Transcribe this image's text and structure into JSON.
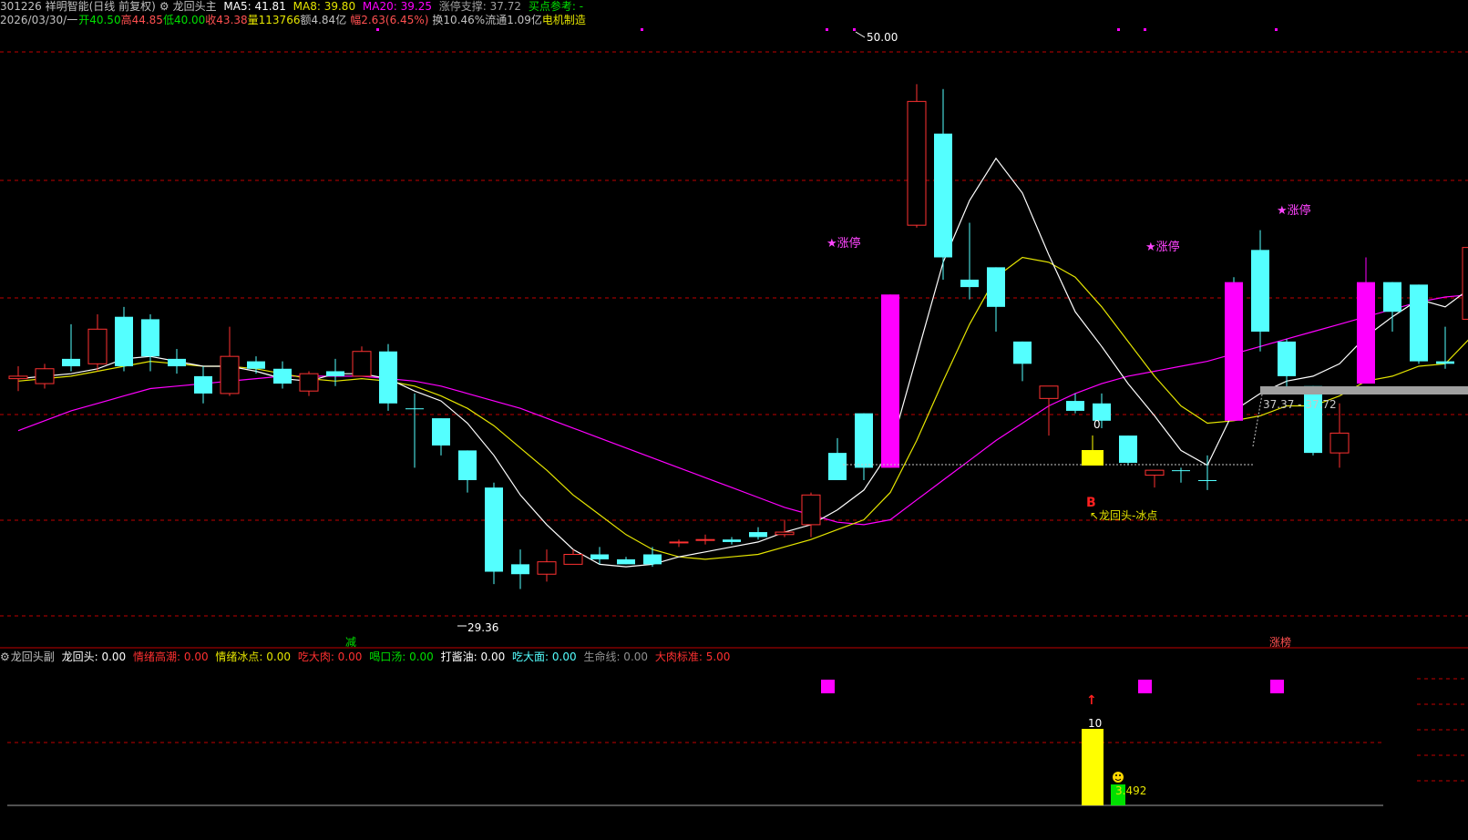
{
  "header": {
    "line1": {
      "code_name": "301226 祥明智能(日线 前复权)",
      "indicator_name": "龙回头主",
      "ma5": "MA5: 41.81",
      "ma8": "MA8: 39.80",
      "ma20": "MA20: 39.25",
      "limit_support": "涨停支撑: 37.72",
      "buy_ref": "买点参考: -"
    },
    "line2": {
      "date": "2026/03/30/一",
      "open": "开40.50",
      "high": "高44.85",
      "low": "低40.00",
      "close": "收43.38",
      "volume": "量113766",
      "amount": "额4.84亿",
      "change": "幅2.63(6.45%)",
      "turnover": "换10.46%",
      "float": "流通1.09亿",
      "sector": "电机制造"
    }
  },
  "colors": {
    "background": "#000000",
    "up_candle": "#ff3232",
    "down_candle": "#54ffff",
    "limit_up_bar": "#ff00ff",
    "ma5": "#ffffff",
    "ma8": "#e5e500",
    "ma20": "#ff00ff",
    "grid": "#8b0000"
  },
  "annotations": {
    "high_label": "50.00",
    "low_label": "29.36",
    "limit_up": "★涨停",
    "b_marker": "B",
    "dragon_text": "↖龙回头-冰点",
    "zero_label": "0",
    "support_range": "37.37 - 37.72",
    "jian": "减",
    "zhangbang": "涨榜"
  },
  "subheader": {
    "name": "龙回头副",
    "longhuitou": "龙回头: 0.00",
    "qingxu_gaochao": "情绪高潮: 0.00",
    "qingxu_bingdian": "情绪冰点: 0.00",
    "chi_darou": "吃大肉: 0.00",
    "he_koutang": "喝口汤: 0.00",
    "da_jiangyou": "打酱油: 0.00",
    "chi_damian": "吃大面: 0.00",
    "shengmingxian": "生命线: 0.00",
    "darou_biaozhun": "大肉标准: 5.00"
  },
  "sub_labels": {
    "ten": "10",
    "value": "3.492"
  },
  "chart_data": {
    "type": "candlestick",
    "ylim": [
      28,
      52
    ],
    "candles": [
      {
        "o": 38.2,
        "h": 38.6,
        "l": 37.6,
        "c": 38.1,
        "up": true
      },
      {
        "o": 38.5,
        "h": 38.7,
        "l": 37.7,
        "c": 37.9,
        "up": true
      },
      {
        "o": 38.6,
        "h": 40.3,
        "l": 38.4,
        "c": 38.9,
        "up": false
      },
      {
        "o": 40.1,
        "h": 40.7,
        "l": 38.4,
        "c": 38.7,
        "up": true
      },
      {
        "o": 38.6,
        "h": 41.0,
        "l": 38.4,
        "c": 40.6,
        "up": false
      },
      {
        "o": 40.5,
        "h": 40.7,
        "l": 38.4,
        "c": 39.0,
        "up": false
      },
      {
        "o": 38.9,
        "h": 39.3,
        "l": 38.3,
        "c": 38.6,
        "up": false
      },
      {
        "o": 38.2,
        "h": 38.6,
        "l": 37.1,
        "c": 37.5,
        "up": false
      },
      {
        "o": 37.5,
        "h": 40.2,
        "l": 37.4,
        "c": 39.0,
        "up": true
      },
      {
        "o": 38.8,
        "h": 39.0,
        "l": 38.3,
        "c": 38.5,
        "up": false
      },
      {
        "o": 38.5,
        "h": 38.8,
        "l": 37.7,
        "c": 37.9,
        "up": false
      },
      {
        "o": 37.6,
        "h": 38.4,
        "l": 37.4,
        "c": 38.3,
        "up": true
      },
      {
        "o": 38.4,
        "h": 38.9,
        "l": 37.8,
        "c": 38.2,
        "up": false
      },
      {
        "o": 38.2,
        "h": 39.4,
        "l": 38.2,
        "c": 39.2,
        "up": true
      },
      {
        "o": 39.2,
        "h": 39.5,
        "l": 36.8,
        "c": 37.1,
        "up": false
      },
      {
        "o": 36.9,
        "h": 37.5,
        "l": 34.5,
        "c": 36.9,
        "up": false
      },
      {
        "o": 36.5,
        "h": 36.5,
        "l": 35.0,
        "c": 35.4,
        "up": false
      },
      {
        "o": 35.2,
        "h": 35.2,
        "l": 33.5,
        "c": 34.0,
        "up": false
      },
      {
        "o": 33.7,
        "h": 33.9,
        "l": 29.8,
        "c": 30.3,
        "up": false
      },
      {
        "o": 30.6,
        "h": 31.2,
        "l": 29.6,
        "c": 30.2,
        "up": false
      },
      {
        "o": 30.2,
        "h": 31.2,
        "l": 29.9,
        "c": 30.7,
        "up": true
      },
      {
        "o": 30.6,
        "h": 31.2,
        "l": 30.6,
        "c": 31.0,
        "up": true
      },
      {
        "o": 31.0,
        "h": 31.3,
        "l": 30.6,
        "c": 30.8,
        "up": false
      },
      {
        "o": 30.8,
        "h": 30.9,
        "l": 30.6,
        "c": 30.6,
        "up": false
      },
      {
        "o": 31.0,
        "h": 31.3,
        "l": 30.5,
        "c": 30.6,
        "up": false
      },
      {
        "o": 31.5,
        "h": 31.6,
        "l": 31.3,
        "c": 31.5,
        "up": true
      },
      {
        "o": 31.6,
        "h": 31.8,
        "l": 31.4,
        "c": 31.6,
        "up": true
      },
      {
        "o": 31.6,
        "h": 31.7,
        "l": 31.4,
        "c": 31.5,
        "up": false
      },
      {
        "o": 31.9,
        "h": 32.1,
        "l": 31.6,
        "c": 31.7,
        "up": false
      },
      {
        "o": 31.8,
        "h": 32.4,
        "l": 31.7,
        "c": 31.9,
        "up": true
      },
      {
        "o": 32.2,
        "h": 33.5,
        "l": 31.7,
        "c": 33.4,
        "up": true
      },
      {
        "o": 35.1,
        "h": 35.7,
        "l": 34.0,
        "c": 34.0,
        "up": false
      },
      {
        "o": 36.7,
        "h": 36.7,
        "l": 34.0,
        "c": 34.5,
        "up": false
      },
      {
        "o": 34.5,
        "h": 41.5,
        "l": 34.5,
        "c": 41.5,
        "up": true,
        "limit": true
      },
      {
        "o": 44.3,
        "h": 50.0,
        "l": 44.2,
        "c": 49.3,
        "up": true
      },
      {
        "o": 48.0,
        "h": 49.8,
        "l": 42.1,
        "c": 43.0,
        "up": false
      },
      {
        "o": 42.1,
        "h": 44.4,
        "l": 41.3,
        "c": 41.8,
        "up": false
      },
      {
        "o": 42.6,
        "h": 42.6,
        "l": 40.0,
        "c": 41.0,
        "up": false
      },
      {
        "o": 39.6,
        "h": 39.6,
        "l": 38.0,
        "c": 38.7,
        "up": false
      },
      {
        "o": 37.8,
        "h": 37.8,
        "l": 35.8,
        "c": 37.3,
        "up": true
      },
      {
        "o": 37.2,
        "h": 37.5,
        "l": 36.7,
        "c": 36.8,
        "up": false
      },
      {
        "o": 37.1,
        "h": 37.5,
        "l": 36.1,
        "c": 36.4,
        "up": false
      },
      {
        "o": 35.8,
        "h": 35.8,
        "l": 34.6,
        "c": 34.7,
        "up": false
      },
      {
        "o": 34.4,
        "h": 34.4,
        "l": 33.7,
        "c": 34.2,
        "up": true
      },
      {
        "o": 34.4,
        "h": 34.5,
        "l": 33.9,
        "c": 34.4,
        "up": false
      },
      {
        "o": 34.0,
        "h": 35.0,
        "l": 33.6,
        "c": 34.0,
        "up": false
      },
      {
        "o": 42.0,
        "h": 42.2,
        "l": 36.4,
        "c": 36.4,
        "up": false,
        "limit": true
      },
      {
        "o": 43.3,
        "h": 44.1,
        "l": 39.2,
        "c": 40.0,
        "up": false
      },
      {
        "o": 39.6,
        "h": 39.7,
        "l": 37.7,
        "c": 38.2,
        "up": false
      },
      {
        "o": 37.8,
        "h": 37.8,
        "l": 35.0,
        "c": 35.1,
        "up": false
      },
      {
        "o": 35.1,
        "h": 37.1,
        "l": 34.5,
        "c": 35.9,
        "up": true
      },
      {
        "o": 42.0,
        "h": 43.0,
        "l": 37.9,
        "c": 37.9,
        "up": true,
        "limit": true
      },
      {
        "o": 42.0,
        "h": 42.0,
        "l": 40.0,
        "c": 40.8,
        "up": false
      },
      {
        "o": 41.9,
        "h": 41.9,
        "l": 38.7,
        "c": 38.8,
        "up": false
      },
      {
        "o": 38.8,
        "h": 40.2,
        "l": 38.5,
        "c": 38.7,
        "up": false
      },
      {
        "o": 40.5,
        "h": 44.8,
        "l": 40.0,
        "c": 43.4,
        "up": true
      }
    ],
    "ma5": [
      38.1,
      38.2,
      38.3,
      38.5,
      38.9,
      39.0,
      38.8,
      38.6,
      38.6,
      38.4,
      38.1,
      38.0,
      38.3,
      38.3,
      38.1,
      37.6,
      37.2,
      36.3,
      35.0,
      33.4,
      32.2,
      31.2,
      30.6,
      30.5,
      30.6,
      30.9,
      31.1,
      31.3,
      31.5,
      31.9,
      32.2,
      32.8,
      33.6,
      35.2,
      39.0,
      42.8,
      45.3,
      47.0,
      45.6,
      43.1,
      40.8,
      39.4,
      37.9,
      36.6,
      35.2,
      34.6,
      36.8,
      37.5,
      38.0,
      38.2,
      38.7,
      39.8,
      40.6,
      41.3,
      41.0,
      41.8
    ],
    "ma8": [
      38.0,
      38.1,
      38.2,
      38.4,
      38.6,
      38.8,
      38.7,
      38.6,
      38.6,
      38.5,
      38.3,
      38.1,
      38.0,
      38.1,
      38.0,
      37.8,
      37.4,
      36.9,
      36.2,
      35.3,
      34.4,
      33.4,
      32.6,
      31.8,
      31.2,
      30.9,
      30.8,
      30.9,
      31.0,
      31.3,
      31.6,
      32.0,
      32.4,
      33.5,
      35.6,
      38.0,
      40.3,
      42.2,
      43.0,
      42.8,
      42.2,
      41.0,
      39.6,
      38.2,
      37.0,
      36.3,
      36.4,
      36.6,
      37.0,
      37.0,
      37.4,
      38.0,
      38.2,
      38.6,
      38.7,
      39.8
    ],
    "ma20": [
      36.0,
      36.4,
      36.8,
      37.1,
      37.4,
      37.7,
      37.8,
      37.9,
      38.0,
      38.1,
      38.2,
      38.2,
      38.2,
      38.2,
      38.1,
      38.0,
      37.8,
      37.5,
      37.2,
      36.9,
      36.5,
      36.1,
      35.7,
      35.3,
      34.9,
      34.5,
      34.1,
      33.7,
      33.3,
      32.9,
      32.6,
      32.3,
      32.2,
      32.4,
      33.2,
      34.0,
      34.8,
      35.6,
      36.3,
      37.0,
      37.5,
      37.9,
      38.2,
      38.4,
      38.6,
      38.8,
      39.1,
      39.4,
      39.7,
      40.0,
      40.3,
      40.6,
      40.9,
      41.2,
      41.4,
      41.5
    ]
  }
}
